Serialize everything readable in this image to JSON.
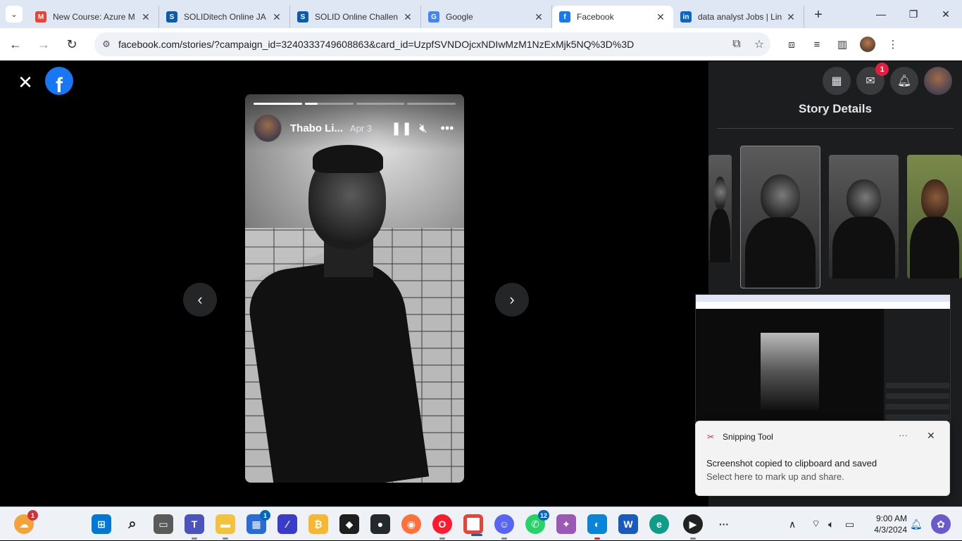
{
  "browser": {
    "tabs": [
      {
        "title": "New Course: Azure M",
        "icon": "gmail-icon",
        "color": "#ea4335",
        "active": false
      },
      {
        "title": "SOLIDitech Online JA",
        "icon": "solid-icon",
        "color": "#0b5cad",
        "active": false
      },
      {
        "title": "SOLID Online Challen",
        "icon": "solid-icon",
        "color": "#0b5cad",
        "active": false
      },
      {
        "title": "Google",
        "icon": "google-icon",
        "color": "#4285f4",
        "active": false
      },
      {
        "title": "Facebook",
        "icon": "facebook-icon",
        "color": "#1877f2",
        "active": true
      },
      {
        "title": "data analyst Jobs | Lin",
        "icon": "linkedin-icon",
        "color": "#0a66c2",
        "active": false
      }
    ],
    "url": "facebook.com/stories/?campaign_id=3240333749608863&card_id=UzpfSVNDOjcxNDIwMzM1NzExMjk5NQ%3D%3D"
  },
  "story": {
    "author": "Thabo Li...",
    "date": "Apr 3",
    "progress": [
      1.0,
      0.27,
      0.0,
      0.0
    ]
  },
  "side": {
    "title": "Story Details",
    "messenger_badge": "1"
  },
  "toast": {
    "app": "Snipping Tool",
    "message": "Screenshot copied to clipboard and saved",
    "sub": "Select here to mark up and share."
  },
  "taskbar": {
    "weather_badge": "1",
    "store_badge": "1",
    "whatsapp_badge": "12",
    "time": "9:00 AM",
    "date": "4/3/2024"
  }
}
